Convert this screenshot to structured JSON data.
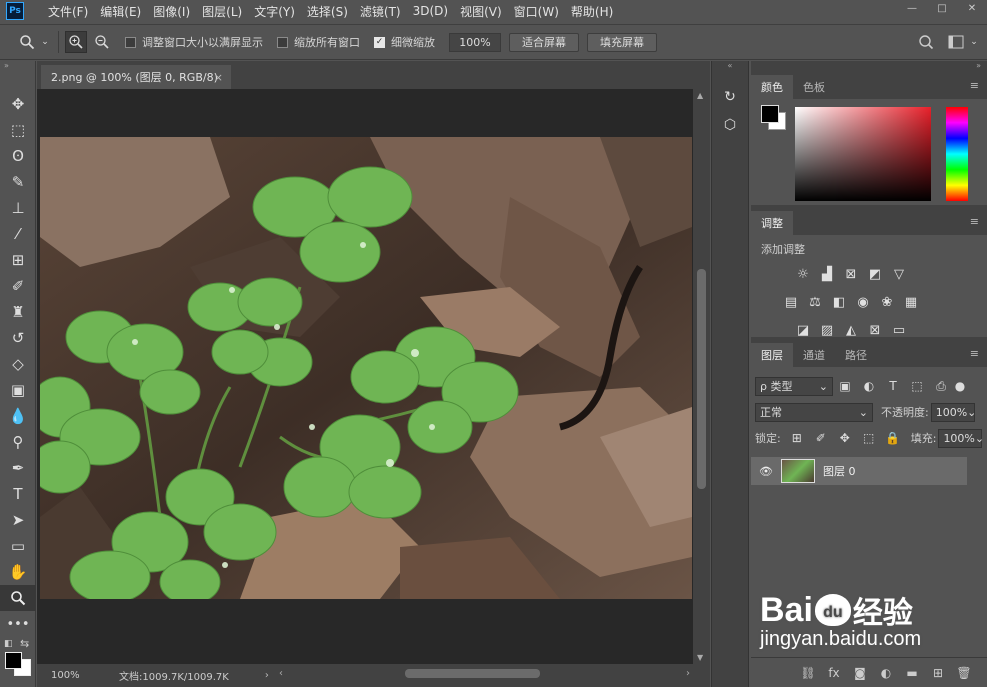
{
  "app": {
    "logo": "Ps"
  },
  "menu": [
    "文件(F)",
    "编辑(E)",
    "图像(I)",
    "图层(L)",
    "文字(Y)",
    "选择(S)",
    "滤镜(T)",
    "3D(D)",
    "视图(V)",
    "窗口(W)",
    "帮助(H)"
  ],
  "window_controls": {
    "minimize": "—",
    "maximize": "□",
    "close": "✕"
  },
  "options": {
    "resize_windows": "调整窗口大小以满屏显示",
    "resize_windows_checked": false,
    "zoom_all_windows": "缩放所有窗口",
    "zoom_all_windows_checked": false,
    "scrubby_zoom": "细微缩放",
    "scrubby_zoom_checked": true,
    "zoom_value": "100%",
    "fit_screen": "适合屏幕",
    "fill_screen": "填充屏幕"
  },
  "document": {
    "tab_title": "2.png @ 100% (图层 0, RGB/8)",
    "tab_close": "×",
    "status_zoom": "100%",
    "status_doc": "文档:1009.7K/1009.7K"
  },
  "panels": {
    "color_tabs": [
      "颜色",
      "色板"
    ],
    "adjust_tab": "调整",
    "adjust_title": "添加调整",
    "layers_tabs": [
      "图层",
      "通道",
      "路径"
    ],
    "kind_label": "ρ 类型",
    "blend_mode": "正常",
    "opacity_label": "不透明度:",
    "opacity_value": "100%",
    "lock_label": "锁定:",
    "fill_label": "填充:",
    "fill_value": "100%",
    "layer_name": "图层 0",
    "panel_menu": "≡"
  },
  "watermark": {
    "brand": "Bai",
    "brand2": "du",
    "brand3": "经验",
    "url": "jingyan.baidu.com"
  },
  "colors": {
    "foreground": "#000000",
    "background": "#ffffff",
    "accent": "#31a8ff"
  }
}
